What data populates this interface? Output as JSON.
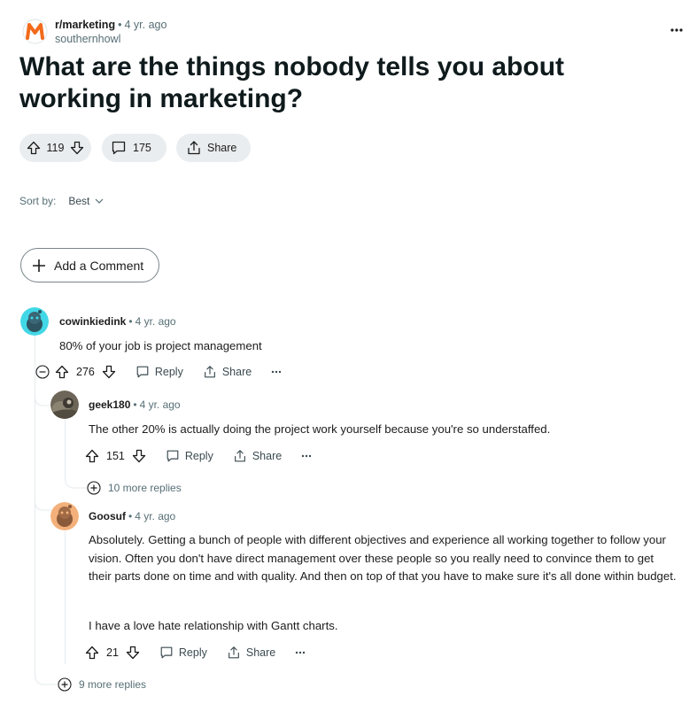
{
  "post": {
    "subreddit": "r/marketing",
    "age": "4 yr. ago",
    "author": "southernhowl",
    "title": "What are the things nobody tells you about working in marketing?",
    "score": "119",
    "comments": "175",
    "share_label": "Share"
  },
  "sort": {
    "label": "Sort by:",
    "value": "Best"
  },
  "add_comment_label": "Add a Comment",
  "comments": [
    {
      "user": "cowinkiedink",
      "age": "4 yr. ago",
      "body": "80% of your job is project management",
      "score": "276",
      "reply_label": "Reply",
      "share_label": "Share",
      "replies": [
        {
          "user": "geek180",
          "age": "4 yr. ago",
          "body": "The other 20% is actually doing the project work yourself because you're so understaffed.",
          "score": "151",
          "reply_label": "Reply",
          "share_label": "Share",
          "more_replies": "10 more replies"
        },
        {
          "user": "Goosuf",
          "age": "4 yr. ago",
          "body_p1": "Absolutely. Getting a bunch of people with different objectives and experience all working together to follow your vision. Often you don't have direct management over these people so you really need to convince them to get their parts done on time and with quality. And then on top of that you have to make sure it's all done within budget.",
          "body_p2": "I have a love hate relationship with Gantt charts.",
          "score": "21",
          "reply_label": "Reply",
          "share_label": "Share"
        }
      ],
      "more_replies": "9 more replies"
    }
  ],
  "colors": {
    "accent_orange": "#f26a1b",
    "pill_bg": "#eaedef",
    "muted_text": "#576f76",
    "avatar_cyan": "#42d7e6",
    "avatar_peach": "#f3b07a"
  }
}
